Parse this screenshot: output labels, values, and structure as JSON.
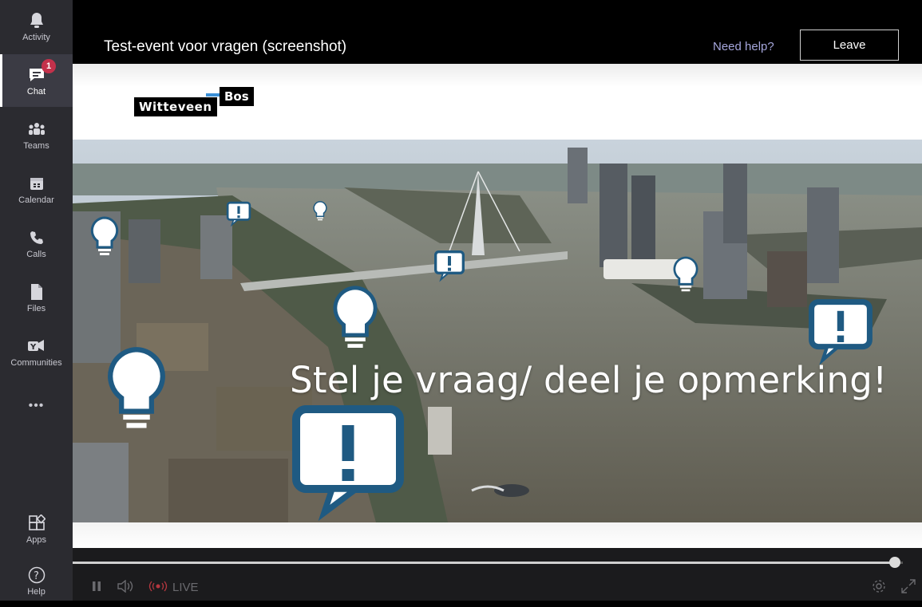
{
  "rail": {
    "items": [
      {
        "label": "Activity",
        "icon": "bell-icon"
      },
      {
        "label": "Chat",
        "icon": "chat-icon",
        "badge": "1",
        "active": true
      },
      {
        "label": "Teams",
        "icon": "teams-icon"
      },
      {
        "label": "Calendar",
        "icon": "calendar-icon"
      },
      {
        "label": "Calls",
        "icon": "phone-icon"
      },
      {
        "label": "Files",
        "icon": "file-icon"
      },
      {
        "label": "Communities",
        "icon": "communities-icon"
      }
    ],
    "more_label": "•••",
    "apps_label": "Apps",
    "help_label": "Help"
  },
  "header": {
    "title": "Test-event voor vragen (screenshot)",
    "help_link": "Need help?",
    "leave_label": "Leave"
  },
  "slide": {
    "logo_left": "Witteveen",
    "logo_right": "Bos",
    "headline": "Stel je vraag/ deel je opmerking!"
  },
  "player": {
    "live_label": "LIVE",
    "progress_fraction": 0.99
  },
  "colors": {
    "rail_bg": "#2b2b30",
    "badge": "#c4314b",
    "link": "#a6a7dc",
    "bubble": "#1f5a82",
    "water": "#6e6b5c"
  }
}
